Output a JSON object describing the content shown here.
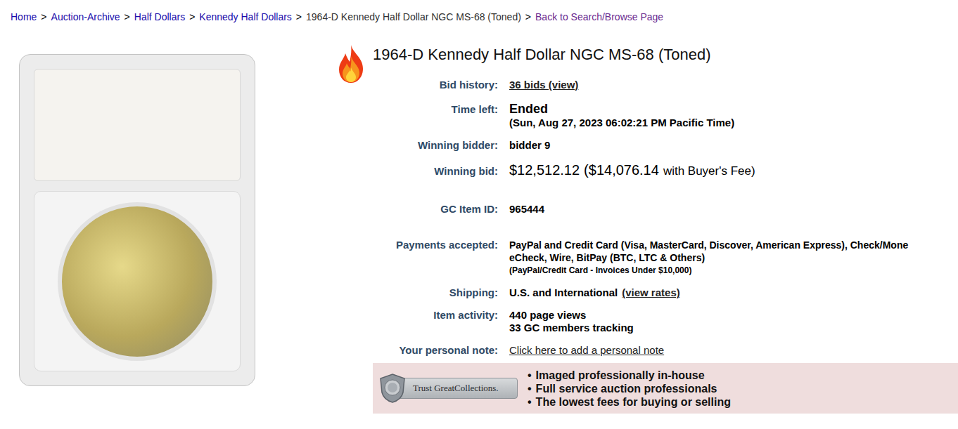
{
  "breadcrumb": {
    "separator": ">",
    "items": [
      {
        "label": "Home",
        "kind": "link"
      },
      {
        "label": "Auction-Archive",
        "kind": "link"
      },
      {
        "label": "Half Dollars",
        "kind": "link"
      },
      {
        "label": "Kennedy Half Dollars",
        "kind": "link"
      },
      {
        "label": "1964-D Kennedy Half Dollar NGC MS-68 (Toned)",
        "kind": "current"
      },
      {
        "label": "Back to Search/Browse Page",
        "kind": "visited"
      }
    ]
  },
  "listing": {
    "hot": true,
    "title": "1964-D Kennedy Half Dollar NGC MS-68 (Toned)",
    "groups": [
      [
        {
          "label": "Bid history:",
          "lines": [
            [
              {
                "text": "36 bids (view)",
                "kind": "link"
              }
            ]
          ]
        },
        {
          "label": "Time left:",
          "lines": [
            [
              {
                "text": "Ended",
                "kind": "big"
              }
            ],
            [
              {
                "text": "(Sun, Aug 27, 2023 06:02:21 PM Pacific Time)",
                "kind": "bold"
              }
            ]
          ]
        },
        {
          "label": "Winning bidder:",
          "lines": [
            [
              {
                "text": "bidder 9",
                "kind": "bold"
              }
            ]
          ]
        },
        {
          "label": "Winning bid:",
          "lines": [
            [
              {
                "text": "$12,512.12",
                "kind": "price"
              },
              {
                "text": "($14,076.14",
                "kind": "price"
              },
              {
                "text": "with Buyer's Fee)",
                "kind": "fee"
              }
            ]
          ]
        }
      ],
      [
        {
          "label": "GC Item ID:",
          "lines": [
            [
              {
                "text": "965444",
                "kind": "bold"
              }
            ]
          ]
        }
      ],
      [
        {
          "label": "Payments accepted:",
          "lines": [
            [
              {
                "text": "PayPal and Credit Card (Visa, MasterCard, Discover, American Express), Check/Mone",
                "kind": "pay"
              }
            ],
            [
              {
                "text": "eCheck, Wire, BitPay (BTC, LTC & Others)",
                "kind": "pay"
              }
            ],
            [
              {
                "text": "(PayPal/Credit Card - Invoices Under $10,000)",
                "kind": "small"
              }
            ]
          ]
        },
        {
          "label": "Shipping:",
          "lines": [
            [
              {
                "text": "U.S. and International",
                "kind": "bold"
              },
              {
                "text": "(view rates)",
                "kind": "link"
              }
            ]
          ]
        },
        {
          "label": "Item activity:",
          "lines": [
            [
              {
                "text": "440 page views",
                "kind": "bold"
              }
            ],
            [
              {
                "text": "33 GC members tracking",
                "kind": "bold"
              }
            ]
          ]
        },
        {
          "label": "Your personal note:",
          "lines": [
            [
              {
                "text": "Click here to add a personal note",
                "kind": "plainlink"
              }
            ]
          ]
        }
      ]
    ]
  },
  "banner": {
    "logo": "Trust GreatCollections.",
    "bullet": "•",
    "items": [
      "Imaged professionally in-house",
      "Full service auction professionals",
      "The lowest fees for buying or selling"
    ]
  }
}
